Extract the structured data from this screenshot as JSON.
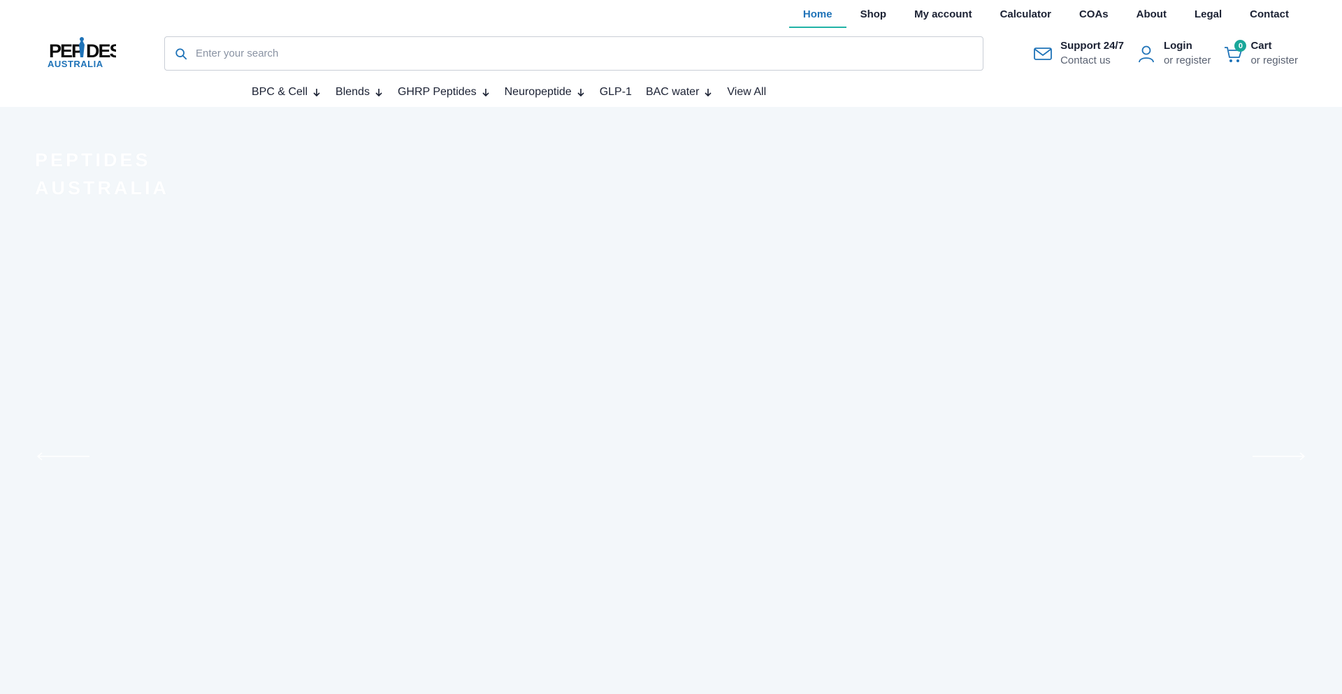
{
  "top_nav": [
    {
      "label": "Home",
      "active": true
    },
    {
      "label": "Shop"
    },
    {
      "label": "My account"
    },
    {
      "label": "Calculator"
    },
    {
      "label": "COAs"
    },
    {
      "label": "About"
    },
    {
      "label": "Legal"
    },
    {
      "label": "Contact"
    }
  ],
  "search": {
    "placeholder": "Enter your search"
  },
  "support": {
    "title": "Support 24/7",
    "subtitle": "Contact us"
  },
  "account": {
    "title": "Login",
    "subtitle": "or register"
  },
  "cart": {
    "title": "Cart",
    "subtitle": "or register",
    "count": "0"
  },
  "categories": [
    {
      "label": "BPC & Cell",
      "has_dropdown": true
    },
    {
      "label": "Blends",
      "has_dropdown": true
    },
    {
      "label": "GHRP Peptides",
      "has_dropdown": true
    },
    {
      "label": "Neuropeptide",
      "has_dropdown": true
    },
    {
      "label": "GLP-1",
      "has_dropdown": false
    },
    {
      "label": "BAC water",
      "has_dropdown": true
    },
    {
      "label": "View All",
      "has_dropdown": false
    }
  ],
  "hero": {
    "brand_line1": "PEPTIDES",
    "brand_line2": "AUSTRALIA"
  },
  "colors": {
    "accent": "#1f73b8",
    "underline": "#22b3a6",
    "badge": "#1aa79a",
    "hero_bg": "#f3f7fa"
  }
}
